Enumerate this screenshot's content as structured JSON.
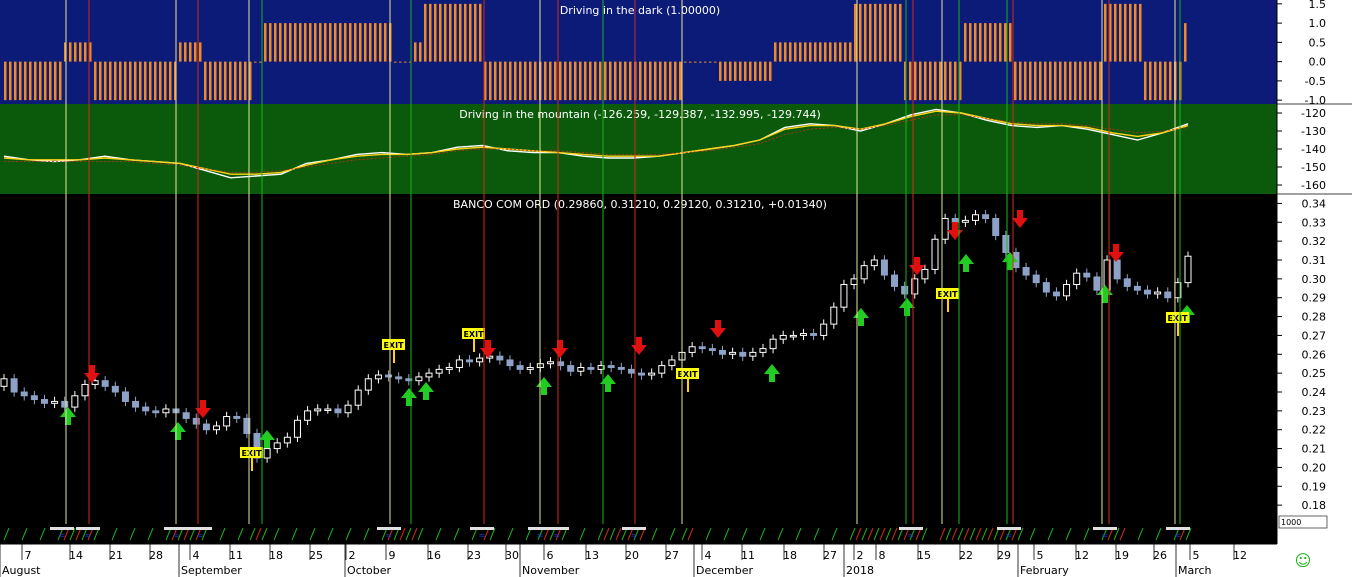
{
  "chart_data": [
    {
      "type": "bar",
      "title": "Driving in the dark (1.00000)",
      "ylim": [
        -1.1,
        1.6
      ],
      "yticks": [
        "1.5",
        "1.0",
        "0.5",
        "0.0",
        "-0.5",
        "-1.0"
      ],
      "background": "#0c1a78",
      "bar_color": "#f08a24",
      "grid": false
    },
    {
      "type": "line",
      "title": "Driving in the mountain (-126.259, -129.387, -132.995, -129.744)",
      "ylim": [
        -165,
        -115
      ],
      "yticks": [
        "-120",
        "-130",
        "-140",
        "-150",
        "-160"
      ],
      "background": "#0b5a0b",
      "series": [
        {
          "color": "#ffffff",
          "values": [
            -144,
            -146,
            -147,
            -146,
            -144,
            -146,
            -147,
            -148,
            -152,
            -156,
            -155,
            -154,
            -148,
            -146,
            -143,
            -142,
            -143,
            -142,
            -139,
            -138,
            -141,
            -142,
            -142,
            -144,
            -145,
            -145,
            -144,
            -142,
            -140,
            -138,
            -135,
            -128,
            -126,
            -127,
            -130,
            -126,
            -121,
            -118,
            -120,
            -124,
            -127,
            -128,
            -127,
            -129,
            -132,
            -135,
            -131,
            -126
          ]
        },
        {
          "color": "#ffd21a",
          "values": [
            -145,
            -146,
            -146,
            -146,
            -145,
            -146,
            -147,
            -148,
            -151,
            -154,
            -154,
            -153,
            -149,
            -146,
            -144,
            -143,
            -143,
            -142,
            -140,
            -139,
            -140,
            -141,
            -142,
            -143,
            -144,
            -144,
            -144,
            -142,
            -140,
            -138,
            -135,
            -129,
            -127,
            -127,
            -129,
            -126,
            -122,
            -119,
            -120,
            -123,
            -126,
            -127,
            -127,
            -128,
            -131,
            -133,
            -131,
            -127
          ]
        },
        {
          "color": "#d12a1a",
          "values": [
            -147,
            -147,
            -147,
            -147,
            -147,
            -147,
            -148,
            -149,
            -151,
            -153,
            -153,
            -152,
            -150,
            -148,
            -146,
            -145,
            -144,
            -143,
            -141,
            -140,
            -140,
            -141,
            -141,
            -142,
            -143,
            -143,
            -143,
            -142,
            -141,
            -139,
            -137,
            -132,
            -129,
            -128,
            -129,
            -127,
            -124,
            -121,
            -121,
            -123,
            -125,
            -126,
            -126,
            -127,
            -129,
            -131,
            -130,
            -128
          ]
        }
      ]
    },
    {
      "type": "candlestick",
      "title": "BANCO COM ORD (0.29860, 0.31210, 0.29120, 0.31210, +0.01340)",
      "ylim": [
        0.17,
        0.345
      ],
      "yticks": [
        "0.34",
        "0.33",
        "0.32",
        "0.31",
        "0.30",
        "0.29",
        "0.28",
        "0.27",
        "0.26",
        "0.25",
        "0.24",
        "0.23",
        "0.22",
        "0.21",
        "0.20",
        "0.19",
        "0.18"
      ],
      "background": "#000000",
      "up_color": "#ffffff",
      "down_color": "#8ea2c8",
      "closes": [
        0.247,
        0.24,
        0.238,
        0.236,
        0.234,
        0.235,
        0.232,
        0.238,
        0.244,
        0.246,
        0.243,
        0.24,
        0.235,
        0.232,
        0.23,
        0.229,
        0.231,
        0.229,
        0.226,
        0.223,
        0.22,
        0.222,
        0.227,
        0.226,
        0.218,
        0.205,
        0.21,
        0.213,
        0.216,
        0.225,
        0.23,
        0.231,
        0.231,
        0.229,
        0.233,
        0.241,
        0.247,
        0.249,
        0.248,
        0.247,
        0.246,
        0.248,
        0.25,
        0.252,
        0.253,
        0.257,
        0.256,
        0.258,
        0.259,
        0.257,
        0.254,
        0.252,
        0.253,
        0.255,
        0.256,
        0.254,
        0.251,
        0.253,
        0.252,
        0.254,
        0.253,
        0.252,
        0.25,
        0.249,
        0.25,
        0.254,
        0.257,
        0.261,
        0.264,
        0.263,
        0.262,
        0.26,
        0.261,
        0.259,
        0.261,
        0.263,
        0.268,
        0.27,
        0.27,
        0.271,
        0.27,
        0.276,
        0.285,
        0.297,
        0.3,
        0.307,
        0.31,
        0.302,
        0.296,
        0.292,
        0.3,
        0.305,
        0.321,
        0.332,
        0.33,
        0.331,
        0.334,
        0.332,
        0.323,
        0.314,
        0.306,
        0.302,
        0.298,
        0.293,
        0.291,
        0.297,
        0.303,
        0.301,
        0.294,
        0.31,
        0.3,
        0.296,
        0.294,
        0.292,
        0.293,
        0.29,
        0.298,
        0.312
      ],
      "exit_labels": [
        "EXIT",
        "EXIT",
        "EXIT",
        "EXIT",
        "EXIT",
        "EXIT"
      ]
    }
  ],
  "x_axis": {
    "day_labels": [
      "7",
      "14",
      "21",
      "28",
      "4",
      "11",
      "18",
      "25",
      "2",
      "9",
      "16",
      "23",
      "30",
      "6",
      "13",
      "20",
      "27",
      "4",
      "11",
      "18",
      "27",
      "2",
      "8",
      "15",
      "22",
      "29",
      "5",
      "12",
      "19",
      "26",
      "5",
      "12"
    ],
    "month_labels": [
      "August",
      "September",
      "October",
      "November",
      "December",
      "2018",
      "February",
      "March"
    ],
    "corner_value": "1000"
  },
  "status": {
    "smiley_icon": "☺"
  }
}
